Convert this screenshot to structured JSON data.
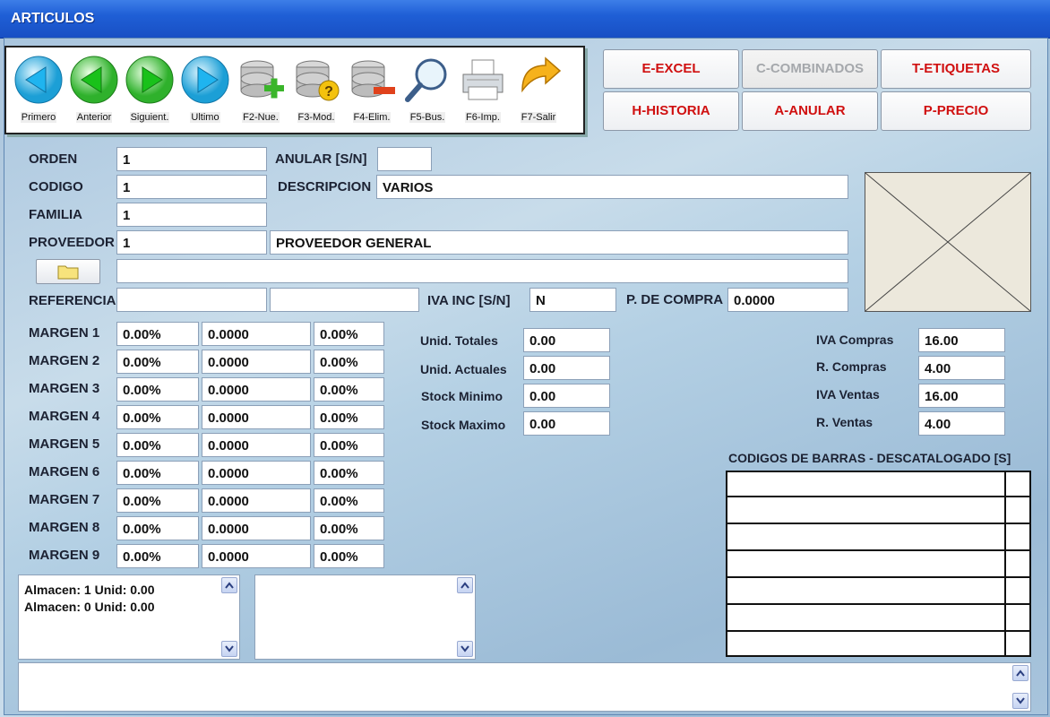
{
  "window": {
    "title": "ARTICULOS"
  },
  "toolbar": {
    "buttons": [
      {
        "label": "Primero",
        "icon": "arrow-left-cyan-icon"
      },
      {
        "label": "Anterior",
        "icon": "arrow-left-green-icon"
      },
      {
        "label": "Siguient.",
        "icon": "arrow-right-green-icon"
      },
      {
        "label": "Ultimo",
        "icon": "arrow-right-cyan-icon"
      },
      {
        "label": "F2-Nue.",
        "icon": "database-add-icon"
      },
      {
        "label": "F3-Mod.",
        "icon": "database-question-icon"
      },
      {
        "label": "F4-Elim.",
        "icon": "database-remove-icon"
      },
      {
        "label": "F5-Bus.",
        "icon": "magnifier-icon"
      },
      {
        "label": "F6-Imp.",
        "icon": "printer-icon"
      },
      {
        "label": "F7-Salir",
        "icon": "exit-arrow-icon"
      }
    ]
  },
  "commands": {
    "excel": "E-EXCEL",
    "combinados": "C-COMBINADOS",
    "etiquetas": "T-ETIQUETAS",
    "historia": "H-HISTORIA",
    "anular": "A-ANULAR",
    "precio": "P-PRECIO"
  },
  "form": {
    "orden": {
      "label": "ORDEN",
      "value": "1"
    },
    "anular": {
      "label": "ANULAR [S/N]",
      "value": ""
    },
    "codigo": {
      "label": "CODIGO",
      "value": "1"
    },
    "descripcion": {
      "label": "DESCRIPCION",
      "value": "VARIOS"
    },
    "familia": {
      "label": "FAMILIA",
      "value": "1"
    },
    "proveedor": {
      "label": "PROVEEDOR",
      "code": "1",
      "name": "PROVEEDOR GENERAL"
    },
    "ruta": {
      "value": ""
    },
    "referencia": {
      "label": "REFERENCIA",
      "value1": "",
      "value2": ""
    },
    "iva_inc": {
      "label": "IVA INC [S/N]",
      "value": "N"
    },
    "p_compra": {
      "label": "P. DE COMPRA",
      "value": "0.0000"
    }
  },
  "margins": [
    {
      "label": "MARGEN 1",
      "pct": "0.00%",
      "price": "0.0000",
      "pct2": "0.00%"
    },
    {
      "label": "MARGEN 2",
      "pct": "0.00%",
      "price": "0.0000",
      "pct2": "0.00%"
    },
    {
      "label": "MARGEN 3",
      "pct": "0.00%",
      "price": "0.0000",
      "pct2": "0.00%"
    },
    {
      "label": "MARGEN 4",
      "pct": "0.00%",
      "price": "0.0000",
      "pct2": "0.00%"
    },
    {
      "label": "MARGEN 5",
      "pct": "0.00%",
      "price": "0.0000",
      "pct2": "0.00%"
    },
    {
      "label": "MARGEN 6",
      "pct": "0.00%",
      "price": "0.0000",
      "pct2": "0.00%"
    },
    {
      "label": "MARGEN 7",
      "pct": "0.00%",
      "price": "0.0000",
      "pct2": "0.00%"
    },
    {
      "label": "MARGEN 8",
      "pct": "0.00%",
      "price": "0.0000",
      "pct2": "0.00%"
    },
    {
      "label": "MARGEN 9",
      "pct": "0.00%",
      "price": "0.0000",
      "pct2": "0.00%"
    }
  ],
  "stock": [
    {
      "label": "Unid. Totales",
      "value": "0.00"
    },
    {
      "label": "Unid. Actuales",
      "value": "0.00"
    },
    {
      "label": "Stock Minimo",
      "value": "0.00"
    },
    {
      "label": "Stock Maximo",
      "value": "0.00"
    }
  ],
  "taxes": [
    {
      "label": "IVA Compras",
      "value": "16.00"
    },
    {
      "label": "R. Compras",
      "value": "4.00"
    },
    {
      "label": "IVA Ventas",
      "value": "16.00"
    },
    {
      "label": "R. Ventas",
      "value": "4.00"
    }
  ],
  "barcodes": {
    "title": "CODIGOS DE BARRAS - DESCATALOGADO [S]",
    "rows": 7
  },
  "almacen": {
    "lines": [
      "Almacen: 1 Unid: 0.00",
      "Almacen: 0 Unid: 0.00"
    ]
  }
}
